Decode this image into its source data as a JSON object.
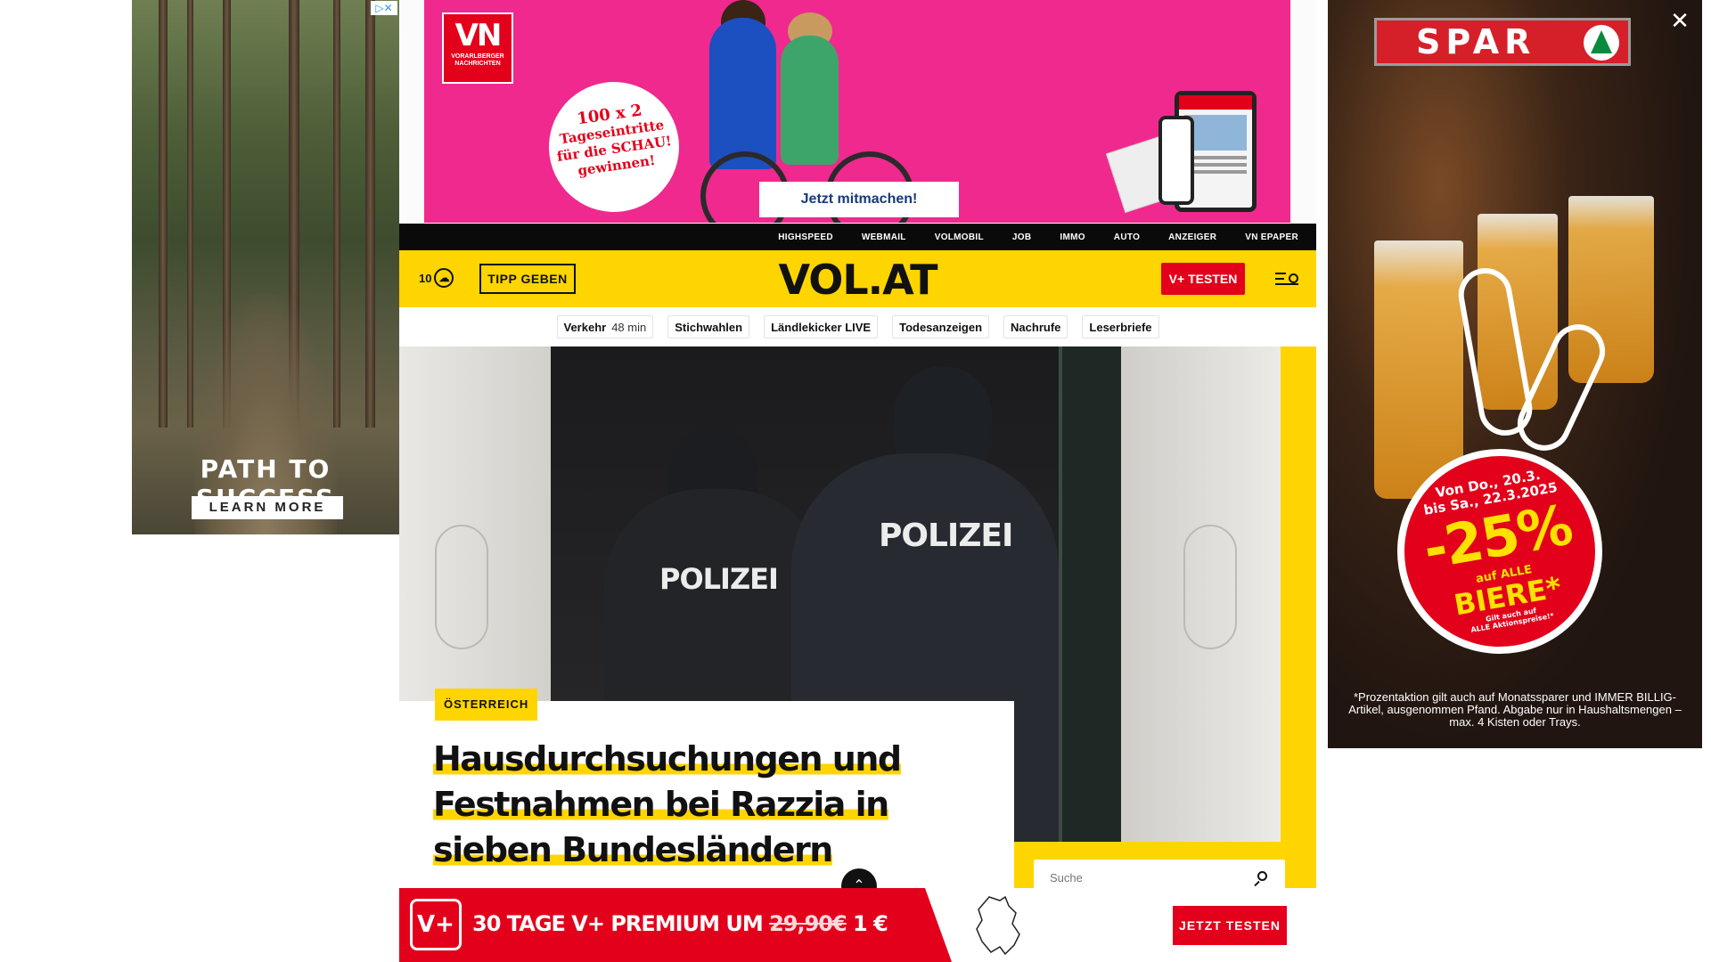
{
  "ads": {
    "left": {
      "headline": "PATH TO SUCCESS",
      "button": "LEARN MORE",
      "adchoices": "▷✕"
    },
    "top": {
      "logo_big": "VN",
      "logo_small": "VORARLBERGER NACHRICHTEN",
      "badge_line1": "100 x 2",
      "badge_line2": "Tageseintritte",
      "badge_line3": "für die SCHAU!",
      "badge_line4": "gewinnen!",
      "button": "Jetzt mitmachen!"
    },
    "right": {
      "brand": "SPAR",
      "close": "✕",
      "date_line1": "Von Do., 20.3.",
      "date_line2": "bis Sa., 22.3.2025",
      "percent": "-25%",
      "auf": "auf ALLE",
      "product": "BIERE*",
      "fine1": "Gilt auch auf",
      "fine2": "ALLE Aktionspreise!*",
      "disclaimer": "*Prozentaktion gilt auch auf Monatssparer und IMMER BILLIG-Artikel, ausgenommen Pfand. Abgabe nur in Haushaltsmengen – max. 4 Kisten oder Trays."
    }
  },
  "topnav": [
    "HIGHSPEED",
    "WEBMAIL",
    "VOLMOBIL",
    "JOB",
    "IMMO",
    "AUTO",
    "ANZEIGER",
    "VN EPAPER"
  ],
  "header": {
    "temperature": "10",
    "weather_icon": "cloud-icon",
    "tipp_button": "TIPP GEBEN",
    "logo": "VOL.AT",
    "vplus_button": "V+ TESTEN",
    "menu_icon": "menu-search-icon"
  },
  "quicklinks": {
    "verkehr": "Verkehr",
    "verkehr_time": "48 min",
    "items": [
      "Stichwahlen",
      "Ländlekicker LIVE",
      "Todesanzeigen",
      "Nachrufe",
      "Leserbriefe"
    ]
  },
  "hero": {
    "photo_label_1": "POLIZEI",
    "photo_label_2": "POLIZEI",
    "category": "ÖSTERREICH",
    "headline_1": "Hausdurchsuchungen und",
    "headline_2": "Festnahmen bei Razzia in",
    "headline_3": "sieben Bundesländern"
  },
  "search": {
    "placeholder": "Suche"
  },
  "promo": {
    "logo": "V+",
    "text_main": "30 TAGE V+ PREMIUM UM",
    "old_price": "29,90€",
    "new_price": "1 €",
    "button": "JETZT TESTEN"
  },
  "colors": {
    "brand_yellow": "#ffd500",
    "brand_red": "#e3001b",
    "ad_pink": "#f0298e"
  }
}
